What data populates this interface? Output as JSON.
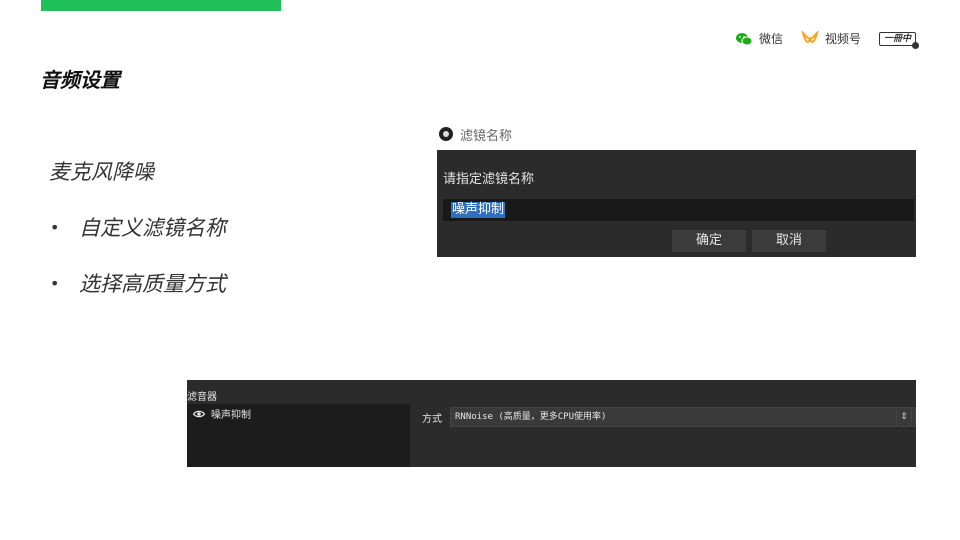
{
  "brand": {
    "wechat_label": "微信",
    "channels_label": "视频号",
    "badge_text": "一冊中"
  },
  "slide": {
    "title": "音频设置",
    "section_heading": "麦克风降噪",
    "bullets": [
      "自定义滤镜名称",
      "选择高质量方式"
    ],
    "bullet_glyph": "•",
    "accent_color": "#1fbf5a"
  },
  "dialog": {
    "title": "滤镜名称",
    "prompt": "请指定滤镜名称",
    "input_value": "噪声抑制",
    "ok_label": "确定",
    "cancel_label": "取消"
  },
  "filters_panel": {
    "header": "滤音器",
    "items": [
      {
        "name": "噪声抑制",
        "visible": true
      }
    ],
    "property_label": "方式",
    "method_value": "RNNoise (高质量，更多CPU使用率)",
    "spinner_glyph": "⇕"
  }
}
